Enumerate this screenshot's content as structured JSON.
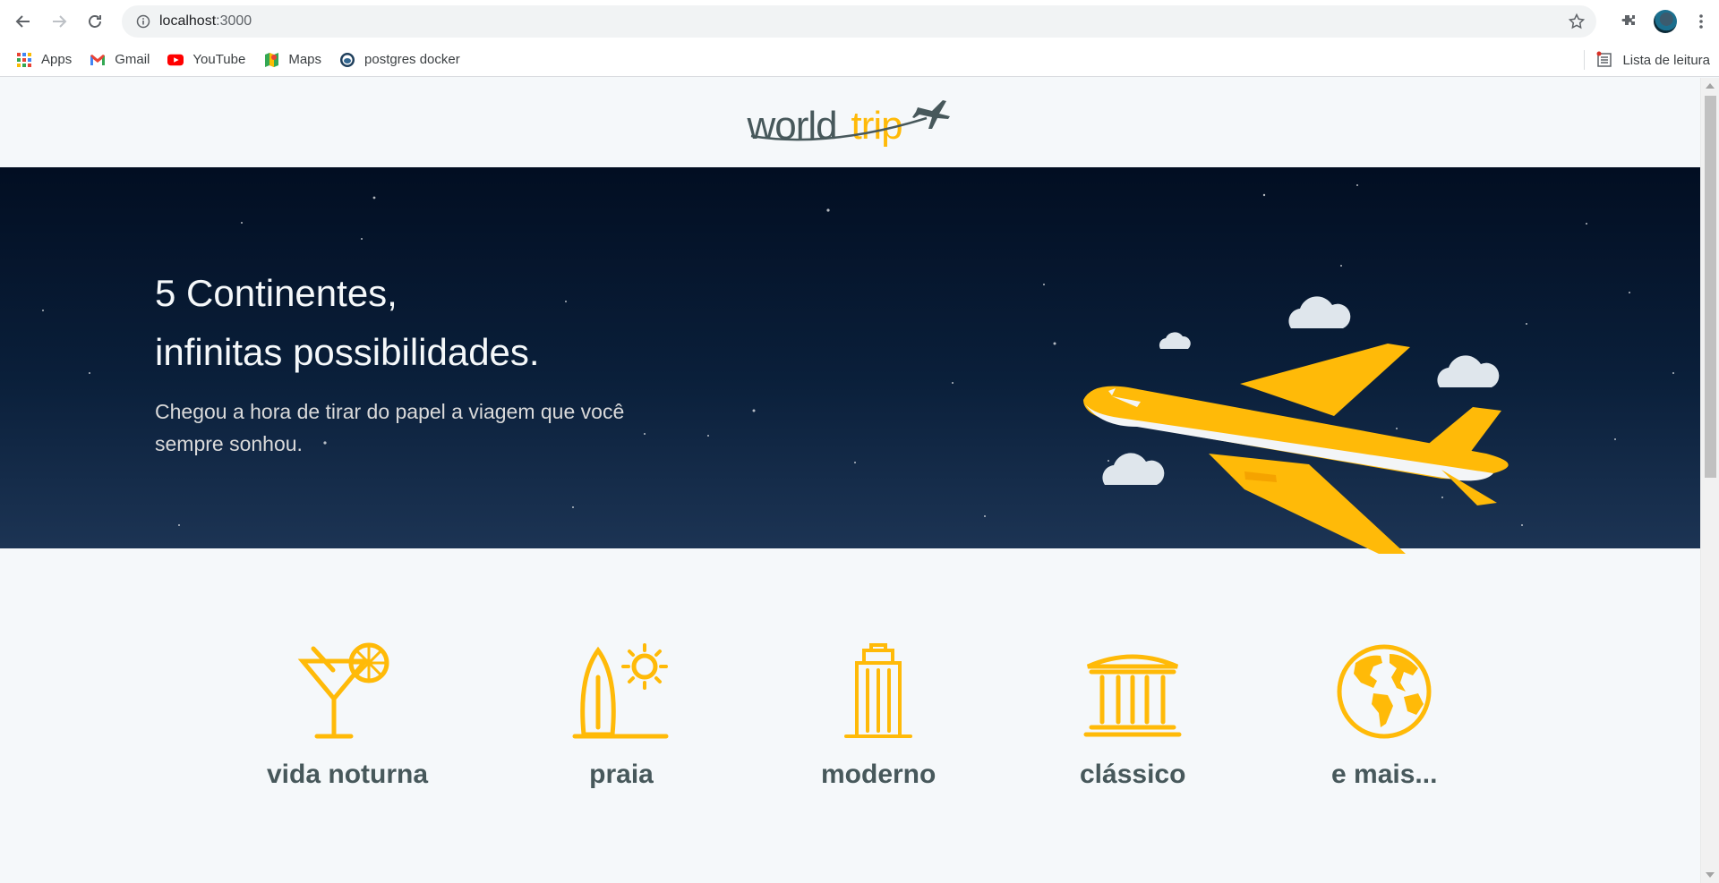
{
  "browser": {
    "url_host": "localhost",
    "url_port": ":3000",
    "nav": {
      "back_icon": "arrow-left-icon",
      "forward_icon": "arrow-right-icon",
      "reload_icon": "reload-icon"
    },
    "bookmarks": [
      {
        "label": "Apps",
        "icon": "apps-grid-icon"
      },
      {
        "label": "Gmail",
        "icon": "gmail-icon"
      },
      {
        "label": "YouTube",
        "icon": "youtube-icon"
      },
      {
        "label": "Maps",
        "icon": "maps-icon"
      },
      {
        "label": "postgres docker",
        "icon": "postgres-icon"
      }
    ],
    "reading_list_label": "Lista de leitura"
  },
  "site": {
    "logo_part1": "world",
    "logo_part2": "trip",
    "hero": {
      "title_line1": "5 Continentes,",
      "title_line2": "infinitas possibilidades.",
      "subtitle": "Chegou a hora de tirar do papel a viagem que você sempre sonhou."
    },
    "travel_types": [
      {
        "label": "vida noturna",
        "icon": "cocktail-icon"
      },
      {
        "label": "praia",
        "icon": "surf-sun-icon"
      },
      {
        "label": "moderno",
        "icon": "building-icon"
      },
      {
        "label": "clássico",
        "icon": "museum-icon"
      },
      {
        "label": "e mais...",
        "icon": "earth-icon"
      }
    ]
  },
  "colors": {
    "brand_yellow": "#ffba08",
    "heading_dark": "#47585b",
    "page_bg": "#f5f8fa",
    "hero_bg": "#0a1f3a"
  }
}
